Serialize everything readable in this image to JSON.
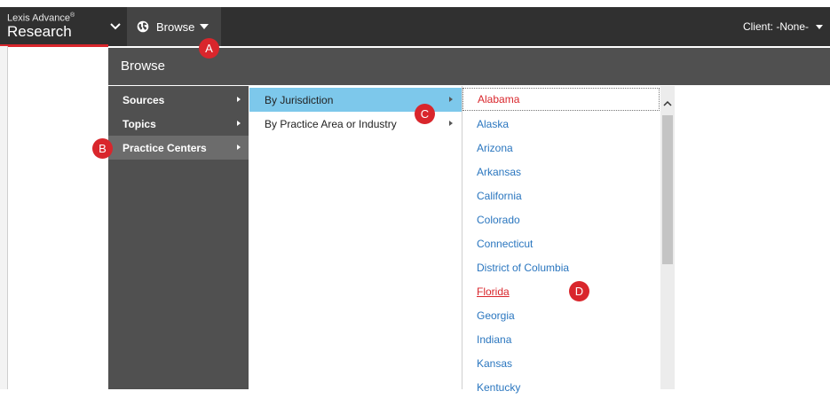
{
  "brand": {
    "line1": "Lexis Advance",
    "reg": "®",
    "line2": "Research"
  },
  "browse_button": {
    "label": "Browse",
    "icon": "globe-icon"
  },
  "client": {
    "label": "Client: -None-"
  },
  "browse_header": {
    "title": "Browse"
  },
  "menu_level1": [
    {
      "label": "Sources"
    },
    {
      "label": "Topics"
    },
    {
      "label": "Practice Centers"
    }
  ],
  "menu_level2": [
    {
      "label": "By Jurisdiction"
    },
    {
      "label": "By Practice Area or Industry"
    }
  ],
  "menu_level3": [
    {
      "label": "Alabama"
    },
    {
      "label": "Alaska"
    },
    {
      "label": "Arizona"
    },
    {
      "label": "Arkansas"
    },
    {
      "label": "California"
    },
    {
      "label": "Colorado"
    },
    {
      "label": "Connecticut"
    },
    {
      "label": "District of Columbia"
    },
    {
      "label": "Florida"
    },
    {
      "label": "Georgia"
    },
    {
      "label": "Indiana"
    },
    {
      "label": "Kansas"
    },
    {
      "label": "Kentucky"
    }
  ],
  "callouts": {
    "a": "A",
    "b": "B",
    "c": "C",
    "d": "D"
  },
  "colors": {
    "accent": "#d9262c",
    "link": "#2a76bf",
    "selected_level2": "#7dc8eb",
    "menu_bg": "#505050",
    "topbar": "#303030"
  }
}
